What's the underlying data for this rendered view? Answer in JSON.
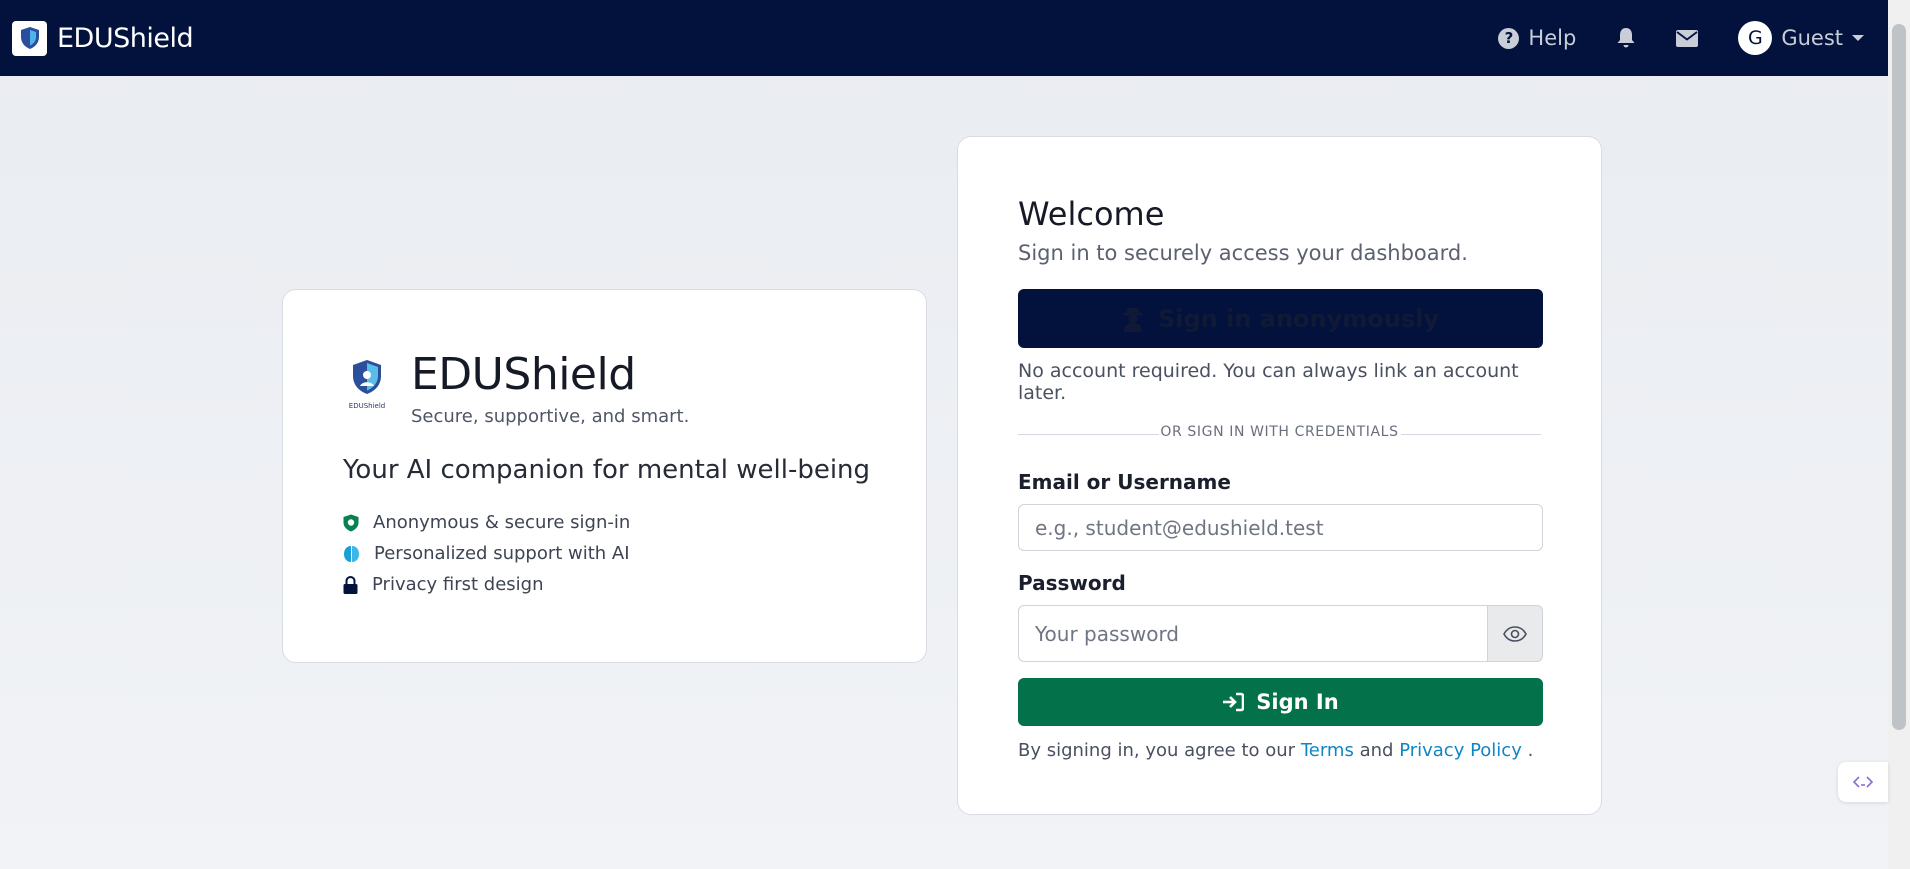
{
  "navbar": {
    "brand": "EDUShield",
    "help_label": "Help",
    "avatar_initial": "G",
    "user_label": "Guest"
  },
  "left_card": {
    "title": "EDUShield",
    "subtitle": "Secure, supportive, and smart.",
    "tagline": "Your AI companion for mental well-being",
    "logo_text": "EDUShield",
    "features": [
      {
        "icon": "shield-check-icon",
        "label": "Anonymous & secure sign-in",
        "color": "#07814f"
      },
      {
        "icon": "brain-icon",
        "label": "Personalized support with AI",
        "color": "#1aa0d8"
      },
      {
        "icon": "lock-icon",
        "label": "Privacy first design",
        "color": "#02123d"
      }
    ]
  },
  "login": {
    "heading": "Welcome",
    "subheading": "Sign in to securely access your dashboard.",
    "anonymous_button": "Sign in anonymously",
    "anonymous_note": "No account required. You can always link an account later.",
    "divider_text": "OR SIGN IN WITH CREDENTIALS",
    "email_label": "Email or Username",
    "email_placeholder": "e.g., student@edushield.test",
    "password_label": "Password",
    "password_placeholder": "Your password",
    "signin_button": "Sign In",
    "agree_prefix": "By signing in, you agree to our",
    "terms_link": "Terms",
    "agree_and": "and",
    "privacy_link": "Privacy Policy",
    "agree_suffix": "."
  },
  "colors": {
    "navbar_bg": "#02123d",
    "primary_green": "#03714a",
    "link_blue": "#1184c5"
  }
}
